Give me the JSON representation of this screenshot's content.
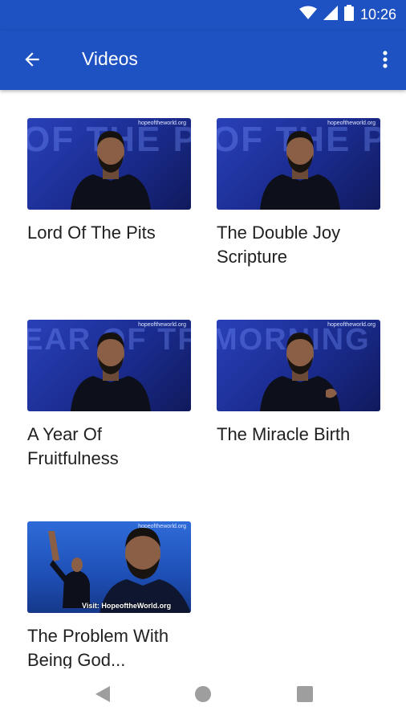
{
  "status_bar": {
    "time": "10:26"
  },
  "app_bar": {
    "title": "Videos"
  },
  "videos": [
    {
      "title": "Lord Of The Pits",
      "thumb_text": "OF THE PITS",
      "watermark": "hopeoftheworld.org"
    },
    {
      "title": "The Double Joy Scripture",
      "thumb_text": "OF THE PITS",
      "watermark": "hopeoftheworld.org"
    },
    {
      "title": "A Year Of Fruitfulness",
      "thumb_text": "EAR OF TFULNESS",
      "watermark": "hopeoftheworld.org"
    },
    {
      "title": "The Miracle Birth",
      "thumb_text": "MORNING S CELEBRA",
      "watermark": "hopeoftheworld.org"
    },
    {
      "title": "The Problem With Being God...",
      "thumb_text": "",
      "watermark": "hopeoftheworld.org",
      "visit_text": "Visit: HopeoftheWorld.org"
    }
  ],
  "colors": {
    "primary": "#1e51c1",
    "title_text": "#212121",
    "nav_icon": "#9e9e9e"
  },
  "icons": {
    "back": "arrow-left-icon",
    "overflow": "more-vert-icon",
    "wifi": "wifi-icon",
    "signal": "signal-icon",
    "battery": "battery-icon",
    "nav_back": "triangle-back-icon",
    "nav_home": "circle-home-icon",
    "nav_recents": "square-recents-icon"
  }
}
